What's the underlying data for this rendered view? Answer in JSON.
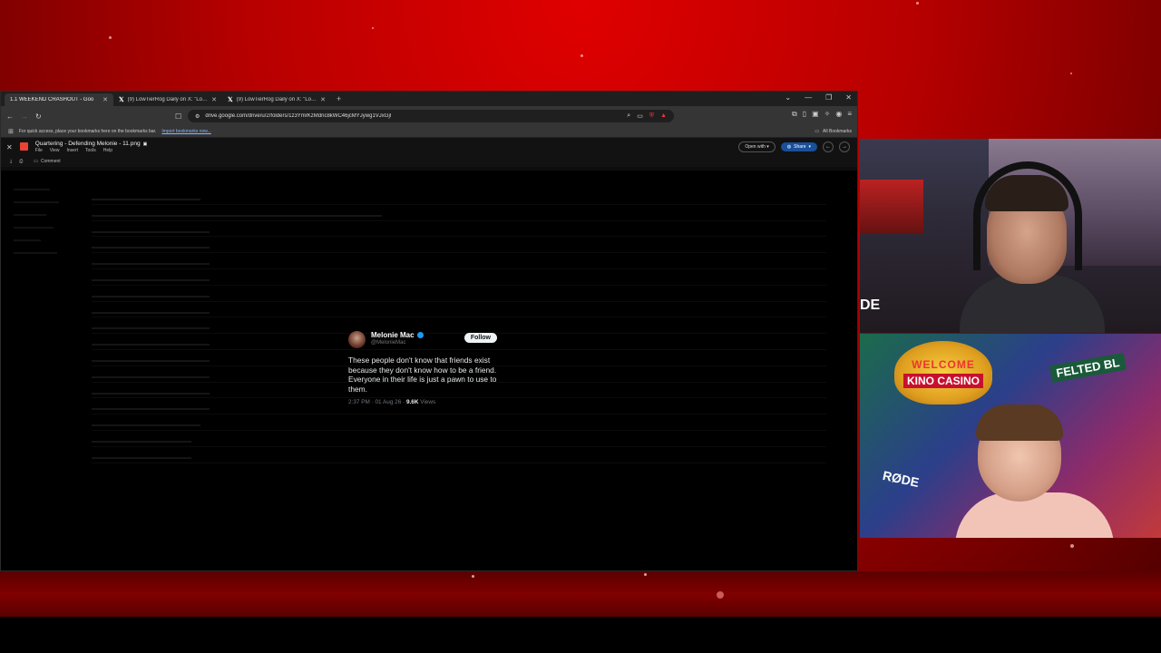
{
  "browser": {
    "tabs": [
      {
        "title": "1.1 WEEKEND CRASHOUT - Goo",
        "active": true
      },
      {
        "title": "(9) LowTierRog Daily on X: \"LowTier",
        "active": false
      },
      {
        "title": "(9) LowTierRog Daily on X: \"LowTier",
        "active": false
      }
    ],
    "url": "drive.google.com/drive/u/2/folders/1z3YmrKzMdnc8kWC46jcMYJywg1VJxGjl",
    "bookmarks_prompt": "For quick access, place your bookmarks here on the bookmarks bar.",
    "import_link": "Import bookmarks now...",
    "all_bookmarks": "All Bookmarks"
  },
  "viewer": {
    "file_title": "Quartering - Defending Melonie - 11.png",
    "menu": [
      "File",
      "View",
      "Insert",
      "Tools",
      "Help"
    ],
    "open_with": "Open with",
    "share": "Share",
    "comment": "Comment"
  },
  "tweet": {
    "name": "Melonie Mac",
    "handle": "@MelonieMac",
    "follow": "Follow",
    "text": "These people don't know that friends exist because they don't know how to be a friend. Everyone in their life is just a pawn to use to them.",
    "timestamp": "2:37 PM · 01 Aug 26 · ",
    "views_count": "9.6K",
    "views_label": " Views"
  },
  "webcams": {
    "top_mic_text": "DE",
    "bottom_sign_welcome": "WELCOME",
    "bottom_sign_casino": "KINO CASINO",
    "bottom_street_sign": "FELTED BL",
    "bottom_mic_text": "RØDE"
  },
  "icons": [
    "back-icon",
    "forward-icon",
    "reload-icon",
    "bookmark-icon",
    "site-info-icon",
    "search-icon",
    "cast-icon",
    "close-icon",
    "share-icon"
  ],
  "colors": {
    "stream_red": "#b80000",
    "share_blue": "#1a4f9a",
    "verified_blue": "#1d9bf0"
  }
}
